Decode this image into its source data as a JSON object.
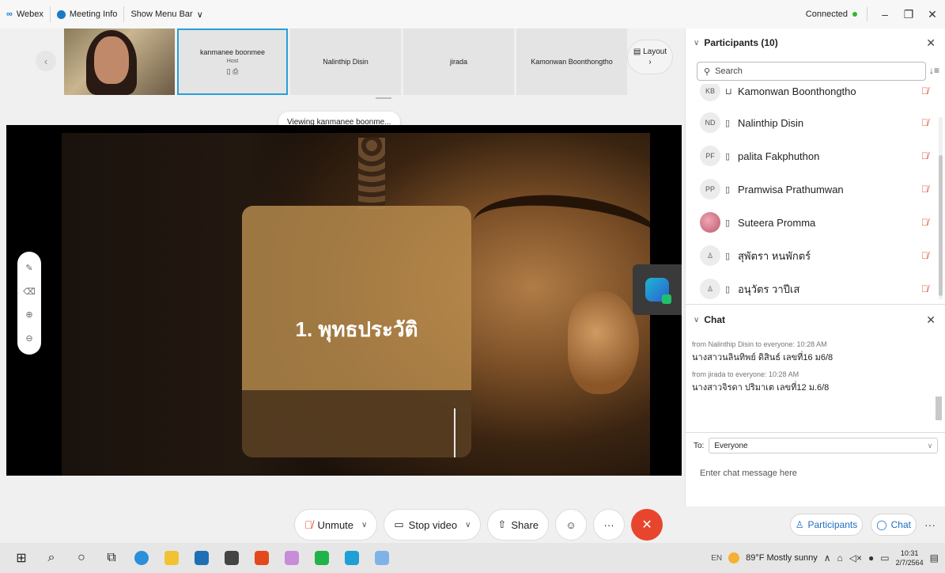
{
  "titlebar": {
    "app_name": "Webex",
    "meeting_info": "Meeting Info",
    "show_menu_bar": "Show Menu Bar",
    "status": "Connected"
  },
  "thumbnails": [
    {
      "name": "kanmanee boonmee",
      "role": "Host",
      "active": true
    },
    {
      "name": "Nalinthip Disin"
    },
    {
      "name": "jirada"
    },
    {
      "name": "Kamonwan Boonthongtho"
    }
  ],
  "layout_label": "Layout",
  "viewing_banner": "Viewing kanmanee boonme...",
  "slide": {
    "title": "1. พุทธประวัติ"
  },
  "controls": {
    "unmute": "Unmute",
    "stop_video": "Stop video",
    "share": "Share"
  },
  "participants": {
    "header": "Participants (10)",
    "search_placeholder": "Search",
    "list": [
      {
        "initials": "KB",
        "name": "Kamonwan Boonthongtho"
      },
      {
        "initials": "ND",
        "name": "Nalinthip Disin"
      },
      {
        "initials": "PF",
        "name": "palita Fakphuthon"
      },
      {
        "initials": "PP",
        "name": "Pramwisa Prathumwan"
      },
      {
        "initials": "",
        "name": "Suteera Promma"
      },
      {
        "initials": "",
        "name": "สุพัตรา หนพักตร์"
      },
      {
        "initials": "",
        "name": "อนุวัตร วาปีเส"
      }
    ]
  },
  "chat": {
    "header": "Chat",
    "messages": [
      {
        "meta": "from Nalinthip Disin to everyone:   10:28 AM",
        "text": "นางสาวนลินทิพย์ ดิสินธ์ เลขที่16 ม6/8"
      },
      {
        "meta": "from jirada to everyone:   10:28 AM",
        "text": "นางสาวจิรดา ปริมาเต เลขที่12 ม.6/8"
      }
    ],
    "to_label": "To:",
    "to_value": "Everyone",
    "input_placeholder": "Enter chat message here"
  },
  "panel_footer": {
    "participants": "Participants",
    "chat": "Chat"
  },
  "taskbar": {
    "weather": "89°F  Mostly sunny",
    "time": "10:31",
    "date": "2/7/2564",
    "lang": "EN"
  }
}
